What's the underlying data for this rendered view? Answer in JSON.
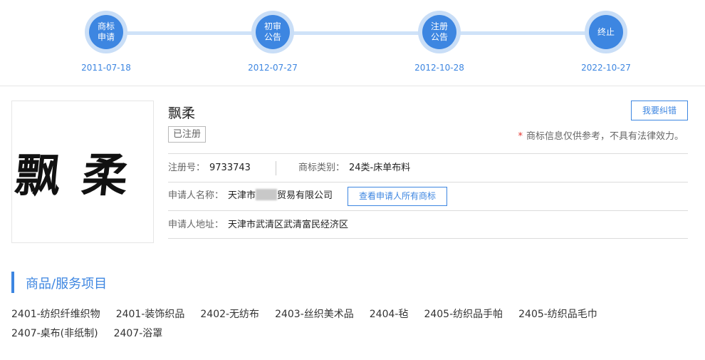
{
  "timeline": {
    "steps": [
      {
        "label": "商标申请",
        "date": "2011-07-18"
      },
      {
        "label": "初审公告",
        "date": "2012-07-27"
      },
      {
        "label": "注册公告",
        "date": "2012-10-28"
      },
      {
        "label": "终止",
        "date": "2022-10-27"
      }
    ]
  },
  "trademark": {
    "logo_text": "飘柔",
    "name": "飘柔",
    "status": "已注册",
    "correct_button": "我要纠错",
    "disclaimer_star": "*",
    "disclaimer": "商标信息仅供参考，不具有法律效力。",
    "reg_no_label": "注册号：",
    "reg_no": "9733743",
    "class_label": "商标类别：",
    "class_value": "24类-床单布料",
    "applicant_label": "申请人名称：",
    "applicant_prefix": "天津市",
    "applicant_suffix": "贸易有限公司",
    "view_all_button": "查看申请人所有商标",
    "address_label": "申请人地址：",
    "address": "天津市武清区武清富民经济区"
  },
  "goods_section": {
    "title": "商品/服务项目",
    "items": [
      "2401-纺织纤维织物",
      "2401-装饰织品",
      "2402-无纺布",
      "2403-丝织美术品",
      "2404-毡",
      "2405-纺织品手帕",
      "2405-纺织品毛巾",
      "2407-桌布(非纸制)",
      "2407-浴罩"
    ]
  }
}
